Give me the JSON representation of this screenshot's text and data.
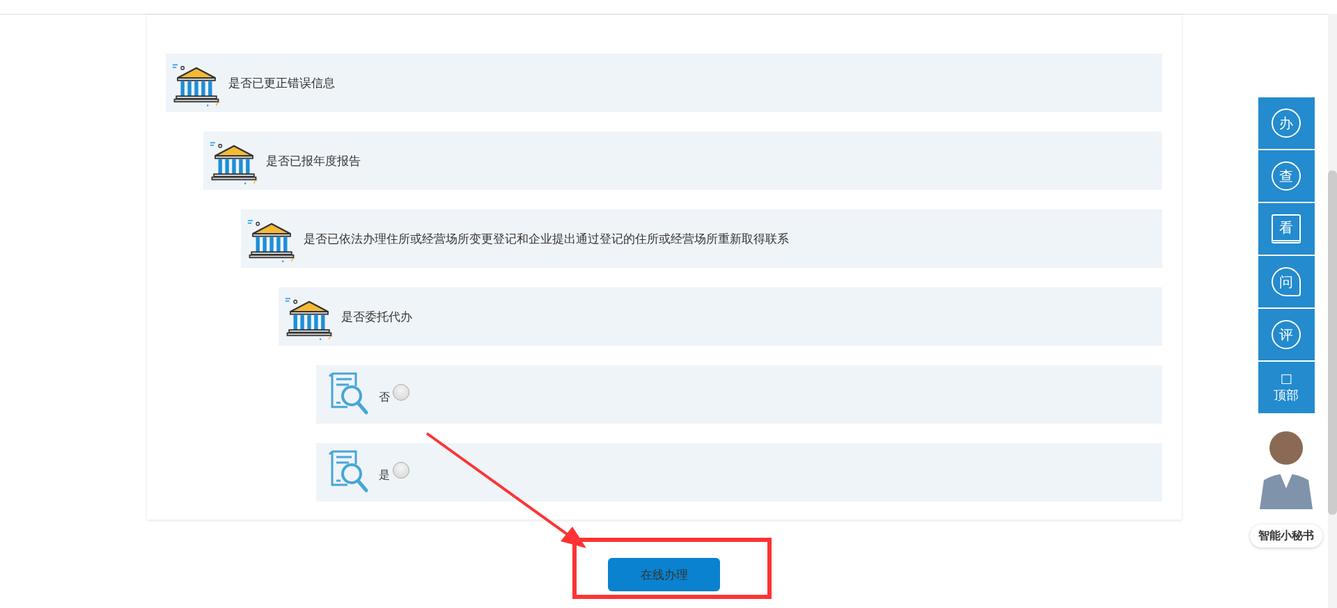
{
  "questions": [
    {
      "kind": "question",
      "text": "是否已更正错误信息",
      "children": [
        {
          "kind": "question",
          "text": "是否已报年度报告",
          "children": [
            {
              "kind": "question",
              "text": "是否已依法办理住所或经营场所变更登记和企业提出通过登记的住所或经营场所重新取得联系",
              "children": [
                {
                  "kind": "question",
                  "text": "是否委托代办",
                  "children": [
                    {
                      "kind": "option",
                      "text": "否",
                      "selected": false
                    },
                    {
                      "kind": "option",
                      "text": "是",
                      "selected": false
                    }
                  ]
                }
              ]
            }
          ]
        }
      ]
    }
  ],
  "submit_button": "在线办理",
  "side_toolbar": [
    {
      "kind": "round",
      "glyph": "办"
    },
    {
      "kind": "search",
      "glyph": "查"
    },
    {
      "kind": "screen",
      "glyph": "看"
    },
    {
      "kind": "bubble",
      "glyph": "问"
    },
    {
      "kind": "round",
      "glyph": "评"
    },
    {
      "kind": "top",
      "glyph": "□",
      "label": "顶部"
    }
  ],
  "assistant_label": "智能小秘书"
}
